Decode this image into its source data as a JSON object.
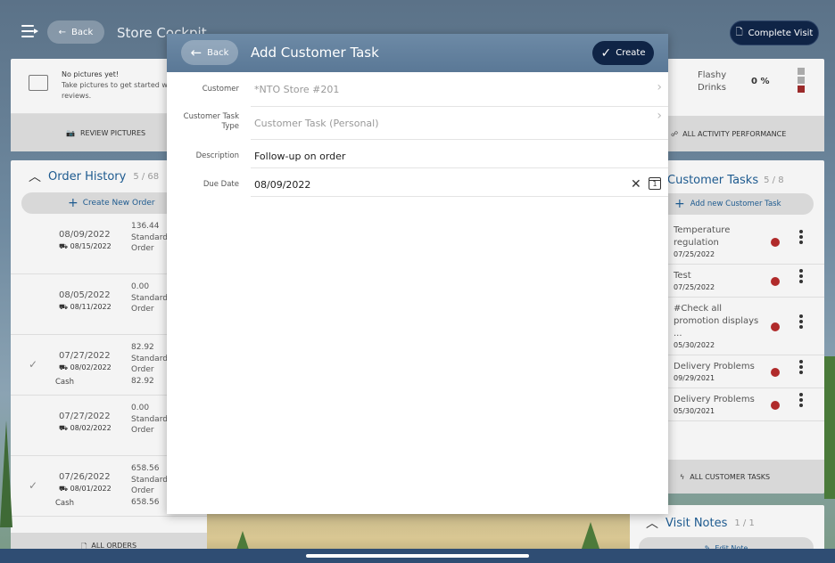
{
  "cockpit": {
    "back_label": "Back",
    "title": "Store Cockpit",
    "complete_visit_label": "Complete Visit",
    "pictures": {
      "heading": "No pictures yet!",
      "text": "Take pictures to get started with your reviews.",
      "review_label": "REVIEW PICTURES"
    },
    "order_history": {
      "title": "Order History",
      "count": "5 / 68",
      "create_label": "Create New Order",
      "all_orders_label": "ALL ORDERS",
      "orders": [
        {
          "date": "08/09/2022",
          "delivery": "08/15/2022",
          "amount": "136.44",
          "type": "Standard",
          "type2": "Order",
          "checked": false,
          "payment": "",
          "paid": ""
        },
        {
          "date": "08/05/2022",
          "delivery": "08/11/2022",
          "amount": "0.00",
          "type": "Standard",
          "type2": "Order",
          "checked": false,
          "payment": "",
          "paid": ""
        },
        {
          "date": "07/27/2022",
          "delivery": "08/02/2022",
          "amount": "82.92",
          "type": "Standard",
          "type2": "Order",
          "checked": true,
          "payment": "Cash",
          "paid": "82.92"
        },
        {
          "date": "07/27/2022",
          "delivery": "08/02/2022",
          "amount": "0.00",
          "type": "Standard",
          "type2": "Order",
          "checked": false,
          "payment": "",
          "paid": ""
        },
        {
          "date": "07/26/2022",
          "delivery": "08/01/2022",
          "amount": "658.56",
          "type": "Standard",
          "type2": "Order",
          "checked": true,
          "payment": "Cash",
          "paid": "658.56"
        }
      ]
    },
    "activity": {
      "label": "Flashy Drinks",
      "percent": "0 %",
      "performance_label": "ALL ACTIVITY PERFORMANCE"
    },
    "customer_tasks": {
      "title": "Customer Tasks",
      "count": "5 / 8",
      "add_label": "Add new Customer Task",
      "all_label": "ALL CUSTOMER TASKS",
      "tasks": [
        {
          "title": "Temperature regulation",
          "date": "07/25/2022"
        },
        {
          "title": "Test",
          "date": "07/25/2022"
        },
        {
          "title": "#Check all promotion displays ...",
          "date": "05/30/2022"
        },
        {
          "title": "Delivery Problems",
          "date": "09/29/2021"
        },
        {
          "title": "Delivery Problems",
          "date": "05/30/2021"
        }
      ]
    },
    "visit_notes": {
      "title": "Visit Notes",
      "count": "1 / 1",
      "edit_label": "Edit Note"
    }
  },
  "modal": {
    "back_label": "Back",
    "title": "Add Customer Task",
    "create_label": "Create",
    "fields": {
      "customer": {
        "label": "Customer",
        "value": "*NTO Store #201"
      },
      "task_type": {
        "label": "Customer Task Type",
        "value": "Customer Task (Personal)"
      },
      "description": {
        "label": "Description",
        "value": "Follow-up on order"
      },
      "due_date": {
        "label": "Due Date",
        "value": "08/09/2022"
      }
    },
    "calendar_day": "1"
  },
  "colors": {
    "accent_dark": "#0f2446",
    "link_blue": "#1d5a8f",
    "status_red": "#b02a2a",
    "header_blue": "#5a7896"
  }
}
